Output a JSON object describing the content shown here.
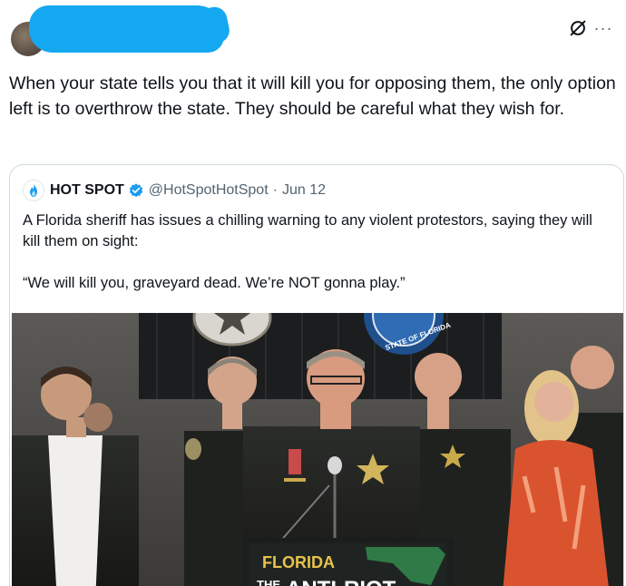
{
  "tweet": {
    "text": "When your state tells you that it will kill you for opposing them, the only option left is to overthrow the state. They should be careful what they wish for."
  },
  "actions": {
    "grok_icon": "grok-icon",
    "more_icon": "more-icon",
    "more_glyph": "···"
  },
  "quote": {
    "author_name": "HOT SPOT",
    "handle": "@HotSpotHotSpot",
    "separator": "·",
    "date": "Jun 12",
    "text_line1": "A Florida sheriff has issues a chilling warning to any violent protestors, saying they will kill them on sight:",
    "text_line2": "“We will kill you, graveyard dead. We’re NOT gonna play.”",
    "media": {
      "podium_line1": "FLORIDA",
      "podium_line2_prefix": "THE",
      "podium_line2": "ANTI-RIOT",
      "seal_text": "STATE OF FLORIDA"
    }
  },
  "colors": {
    "verified_blue": "#1d9bf0",
    "redaction_blue": "#14a8f0",
    "text_primary": "#0f1419",
    "text_secondary": "#536471",
    "border": "#cfd9de"
  }
}
